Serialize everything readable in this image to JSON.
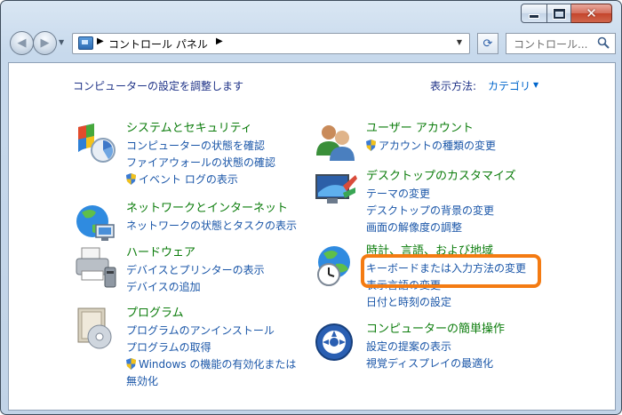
{
  "window": {
    "controls": {
      "minimize": "minimize-icon",
      "maximize": "maximize-icon",
      "close": "close-icon"
    }
  },
  "nav": {
    "address_path": "コントロール パネル",
    "search_placeholder": "コントロール..."
  },
  "content": {
    "page_title": "コンピューターの設定を調整します",
    "view_by_label": "表示方法:",
    "view_by_value": "カテゴリ"
  },
  "categories_left": [
    {
      "title": "システムとセキュリティ",
      "icon": "system-security-icon",
      "links": [
        {
          "label": "コンピューターの状態を確認",
          "shield": false
        },
        {
          "label": "ファイアウォールの状態の確認",
          "shield": false
        },
        {
          "label": "イベント ログの表示",
          "shield": true
        }
      ]
    },
    {
      "title": "ネットワークとインターネット",
      "icon": "network-internet-icon",
      "links": [
        {
          "label": "ネットワークの状態とタスクの表示",
          "shield": false
        }
      ]
    },
    {
      "title": "ハードウェア",
      "icon": "hardware-printer-icon",
      "links": [
        {
          "label": "デバイスとプリンターの表示",
          "shield": false
        },
        {
          "label": "デバイスの追加",
          "shield": false
        }
      ]
    },
    {
      "title": "プログラム",
      "icon": "programs-icon",
      "links": [
        {
          "label": "プログラムのアンインストール",
          "shield": false
        },
        {
          "label": "プログラムの取得",
          "shield": false
        },
        {
          "label": "Windows の機能の有効化または無効化",
          "shield": true
        }
      ]
    }
  ],
  "categories_right": [
    {
      "title": "ユーザー アカウント",
      "icon": "user-accounts-icon",
      "links": [
        {
          "label": "アカウントの種類の変更",
          "shield": true
        }
      ]
    },
    {
      "title": "デスクトップのカスタマイズ",
      "icon": "desktop-customize-icon",
      "links": [
        {
          "label": "テーマの変更",
          "shield": false
        },
        {
          "label": "デスクトップの背景の変更",
          "shield": false
        },
        {
          "label": "画面の解像度の調整",
          "shield": false
        }
      ]
    },
    {
      "title": "時計、言語、および地域",
      "icon": "clock-language-region-icon",
      "links": [
        {
          "label": "キーボードまたは入力方法の変更",
          "shield": false
        },
        {
          "label": "表示言語の変更",
          "shield": false
        },
        {
          "label": "日付と時刻の設定",
          "shield": false
        }
      ]
    },
    {
      "title": "コンピューターの簡単操作",
      "icon": "ease-of-access-icon",
      "links": [
        {
          "label": "設定の提案の表示",
          "shield": false
        },
        {
          "label": "視覚ディスプレイの最適化",
          "shield": false
        }
      ]
    }
  ],
  "colors": {
    "category_title": "#0b7c0b",
    "link": "#1a56a8",
    "heading": "#1e3287",
    "highlight": "#f47b12"
  }
}
